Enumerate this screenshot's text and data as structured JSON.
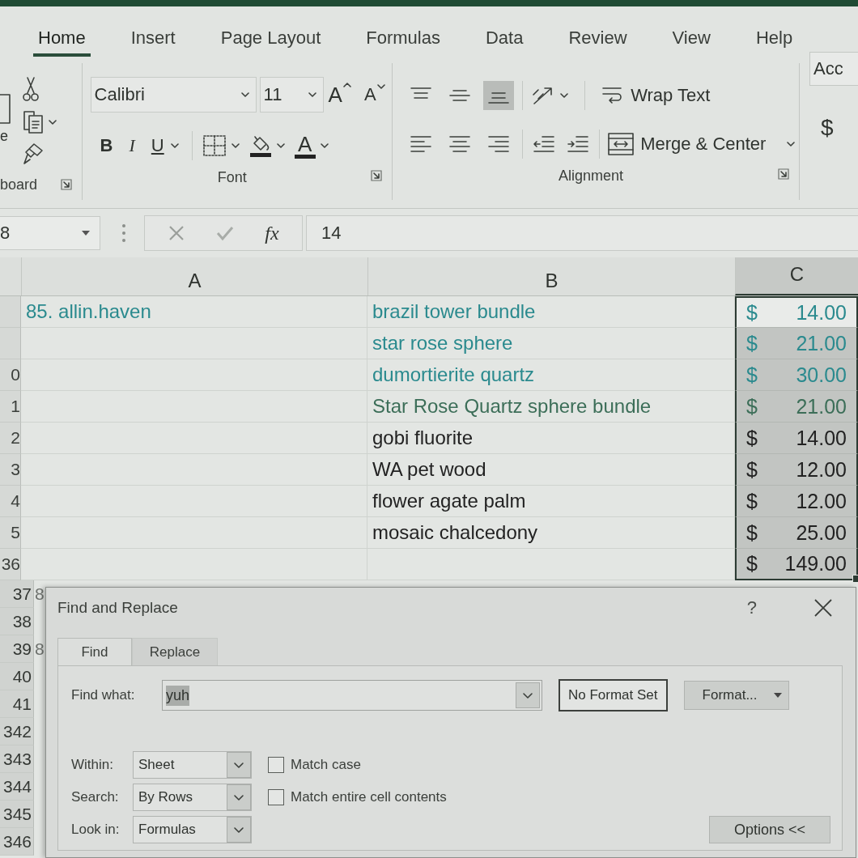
{
  "ribbon_tabs": [
    {
      "label": "Home",
      "selected": true
    },
    {
      "label": "Insert",
      "selected": false
    },
    {
      "label": "Page Layout",
      "selected": false
    },
    {
      "label": "Formulas",
      "selected": false
    },
    {
      "label": "Data",
      "selected": false
    },
    {
      "label": "Review",
      "selected": false
    },
    {
      "label": "View",
      "selected": false
    },
    {
      "label": "Help",
      "selected": false
    }
  ],
  "clipboard": {
    "paste_label": "e",
    "group_label": "board"
  },
  "font": {
    "name": "Calibri",
    "size": "11",
    "grow": "A",
    "shrink": "A",
    "bold": "B",
    "italic": "I",
    "underline": "U",
    "font_color": "A",
    "group_label": "Font"
  },
  "alignment": {
    "vertical": [
      {
        "kind": "top",
        "selected": false
      },
      {
        "kind": "middle",
        "selected": false
      },
      {
        "kind": "bottom",
        "selected": true
      }
    ],
    "horizontal": [
      {
        "kind": "left",
        "selected": false
      },
      {
        "kind": "center",
        "selected": false
      },
      {
        "kind": "right",
        "selected": false
      }
    ],
    "wrap_text": "Wrap Text",
    "merge": "Merge & Center",
    "group_label": "Alignment"
  },
  "number": {
    "format": "Acc",
    "currency": "$"
  },
  "formula_bar": {
    "name_box": "8",
    "function": "fx",
    "value": "14"
  },
  "columns": [
    {
      "label": "A",
      "selected": false
    },
    {
      "label": "B",
      "selected": false
    },
    {
      "label": "C",
      "selected": true
    }
  ],
  "rows": [
    {
      "a": "85. allin.haven",
      "b": "brazil tower bundle",
      "color": "#2a8a8e",
      "currency": "$",
      "amount": "14.00",
      "selected": true,
      "active": true
    },
    {
      "b": "star rose sphere",
      "color": "#2a8a8e",
      "currency": "$",
      "amount": "21.00",
      "selected": true,
      "active": false
    },
    {
      "header": "0",
      "b": "dumortierite quartz",
      "color": "#2a8a8e",
      "currency": "$",
      "amount": "30.00",
      "selected": true,
      "active": false
    },
    {
      "header": "1",
      "b": "Star Rose Quartz sphere bundle",
      "color": "#3c6e58",
      "currency": "$",
      "amount": "21.00",
      "selected": true,
      "active": false
    },
    {
      "header": "2",
      "b": "gobi fluorite",
      "color": "#222222",
      "currency": "$",
      "amount": "14.00",
      "selected": true,
      "active": false
    },
    {
      "header": "3",
      "b": "WA pet wood",
      "color": "#222222",
      "currency": "$",
      "amount": "12.00",
      "selected": true,
      "active": false
    },
    {
      "header": "4",
      "b": "flower agate palm",
      "color": "#222222",
      "currency": "$",
      "amount": "12.00",
      "selected": true,
      "active": false
    },
    {
      "header": "5",
      "b": "mosaic chalcedony",
      "color": "#222222",
      "currency": "$",
      "amount": "25.00",
      "selected": true,
      "active": false
    },
    {
      "header": "36",
      "color": "#222222",
      "currency": "$",
      "amount": "149.00",
      "selected": true,
      "active": false
    }
  ],
  "lower_rows": [
    {
      "header": "37",
      "a": "8"
    },
    {
      "header": "38"
    },
    {
      "header": "39",
      "a": "8"
    },
    {
      "header": "40"
    },
    {
      "header": "41"
    },
    {
      "header": "342"
    },
    {
      "header": "343"
    },
    {
      "header": "344"
    },
    {
      "header": "345"
    },
    {
      "header": "346"
    }
  ],
  "dialog": {
    "title": "Find and Replace",
    "help": "?",
    "tabs": [
      {
        "label": "Find",
        "selected": true
      },
      {
        "label": "Replace",
        "selected": false
      }
    ],
    "find_label": "Find what:",
    "find_value": "yuh",
    "find_value_selected": true,
    "format_status": "No Format Set",
    "format_button": "Format...",
    "options": [
      {
        "label": "Within:",
        "value": "Sheet"
      },
      {
        "label": "Search:",
        "value": "By Rows"
      },
      {
        "label": "Look in:",
        "value": "Formulas"
      }
    ],
    "checks": [
      {
        "label": "Match case",
        "checked": false
      },
      {
        "label": "Match entire cell contents",
        "checked": false
      }
    ],
    "options_button": "Options <<"
  }
}
